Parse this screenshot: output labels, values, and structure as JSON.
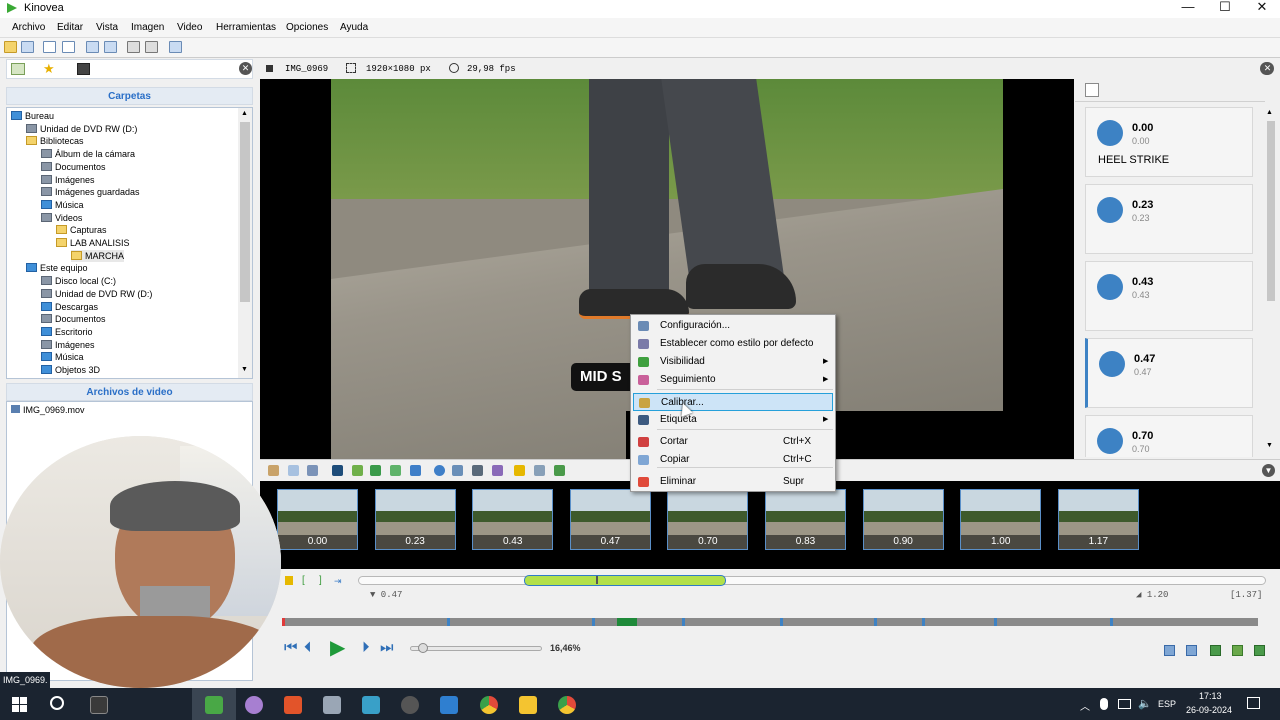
{
  "window": {
    "title": "Kinovea"
  },
  "menu": [
    "Archivo",
    "Editar",
    "Vista",
    "Imagen",
    "Video",
    "Herramientas",
    "Opciones",
    "Ayuda"
  ],
  "left": {
    "folders_header": "Carpetas",
    "tree": [
      {
        "label": "Bureau",
        "indent": 0,
        "icon": "blue"
      },
      {
        "label": "Unidad de DVD RW (D:)",
        "indent": 1,
        "icon": "gray"
      },
      {
        "label": "Bibliotecas",
        "indent": 1,
        "icon": "fold"
      },
      {
        "label": "Álbum de la cámara",
        "indent": 2,
        "icon": "gray"
      },
      {
        "label": "Documentos",
        "indent": 2,
        "icon": "gray"
      },
      {
        "label": "Imágenes",
        "indent": 2,
        "icon": "gray"
      },
      {
        "label": "Imágenes guardadas",
        "indent": 2,
        "icon": "gray"
      },
      {
        "label": "Música",
        "indent": 2,
        "icon": "blue"
      },
      {
        "label": "Videos",
        "indent": 2,
        "icon": "gray"
      },
      {
        "label": "Capturas",
        "indent": 3,
        "icon": "fold"
      },
      {
        "label": "LAB ANALISIS",
        "indent": 3,
        "icon": "fold"
      },
      {
        "label": "MARCHA",
        "indent": 4,
        "icon": "fold"
      },
      {
        "label": "Este equipo",
        "indent": 1,
        "icon": "blue"
      },
      {
        "label": "Disco local (C:)",
        "indent": 2,
        "icon": "gray"
      },
      {
        "label": "Unidad de DVD RW (D:)",
        "indent": 2,
        "icon": "gray"
      },
      {
        "label": "Descargas",
        "indent": 2,
        "icon": "blue"
      },
      {
        "label": "Documentos",
        "indent": 2,
        "icon": "gray"
      },
      {
        "label": "Escritorio",
        "indent": 2,
        "icon": "blue"
      },
      {
        "label": "Imágenes",
        "indent": 2,
        "icon": "gray"
      },
      {
        "label": "Música",
        "indent": 2,
        "icon": "blue"
      },
      {
        "label": "Objetos 3D",
        "indent": 2,
        "icon": "blue"
      }
    ],
    "videos_header": "Archivos de video",
    "files": [
      "IMG_0969.mov"
    ]
  },
  "player": {
    "filename": "IMG_0969",
    "resolution": "1920×1080 px",
    "fps": "29,98 fps",
    "label_overlay": "MID S"
  },
  "keyframes": [
    {
      "time": "0.00",
      "sub": "0.00",
      "title": "HEEL STRIKE",
      "selected": false
    },
    {
      "time": "0.23",
      "sub": "0.23",
      "title": "",
      "selected": false
    },
    {
      "time": "0.43",
      "sub": "0.43",
      "title": "",
      "selected": false
    },
    {
      "time": "0.47",
      "sub": "0.47",
      "title": "",
      "selected": true
    },
    {
      "time": "0.70",
      "sub": "0.70",
      "title": "",
      "selected": false
    }
  ],
  "context_menu": [
    {
      "label": "Configuración...",
      "shortcut": "",
      "submenu": false,
      "icon": "pencil-icon",
      "color": "#6a8bb5"
    },
    {
      "label": "Establecer como estilo por defecto",
      "shortcut": "",
      "submenu": false,
      "icon": "grid-icon",
      "color": "#7a7aa8"
    },
    {
      "label": "Visibilidad",
      "shortcut": "",
      "submenu": true,
      "icon": "visibility-icon",
      "color": "#3fa03f"
    },
    {
      "label": "Seguimiento",
      "shortcut": "",
      "submenu": true,
      "icon": "tracking-icon",
      "color": "#c9609a"
    },
    {
      "label": "Calibrar...",
      "shortcut": "",
      "submenu": false,
      "icon": "ruler-icon",
      "color": "#c9a340",
      "highlighted": true
    },
    {
      "label": "Etiqueta",
      "shortcut": "",
      "submenu": true,
      "icon": "label-icon",
      "color": "#3d5a80"
    },
    {
      "label": "Cortar",
      "shortcut": "Ctrl+X",
      "submenu": false,
      "icon": "cut-icon",
      "color": "#d04040"
    },
    {
      "label": "Copiar",
      "shortcut": "Ctrl+C",
      "submenu": false,
      "icon": "copy-icon",
      "color": "#7fa6d4"
    },
    {
      "label": "Eliminar",
      "shortcut": "Supr",
      "submenu": false,
      "icon": "delete-icon",
      "color": "#e04a3a"
    }
  ],
  "thumbnails": [
    "0.00",
    "0.23",
    "0.43",
    "0.47",
    "0.70",
    "0.83",
    "0.90",
    "1.00",
    "1.17"
  ],
  "timeline": {
    "start": "▼ 0.47",
    "end": "◢ 1.20",
    "total": "[1.37]",
    "speed": "16,46%"
  },
  "taskbar": {
    "lang": "ESP",
    "time": "17:13",
    "date": "26-09-2024",
    "preview_label": "IMG_0969."
  },
  "colors": {
    "accent": "#3d82c4",
    "selection": "#cde4f7",
    "trim": "#b2e04a"
  }
}
